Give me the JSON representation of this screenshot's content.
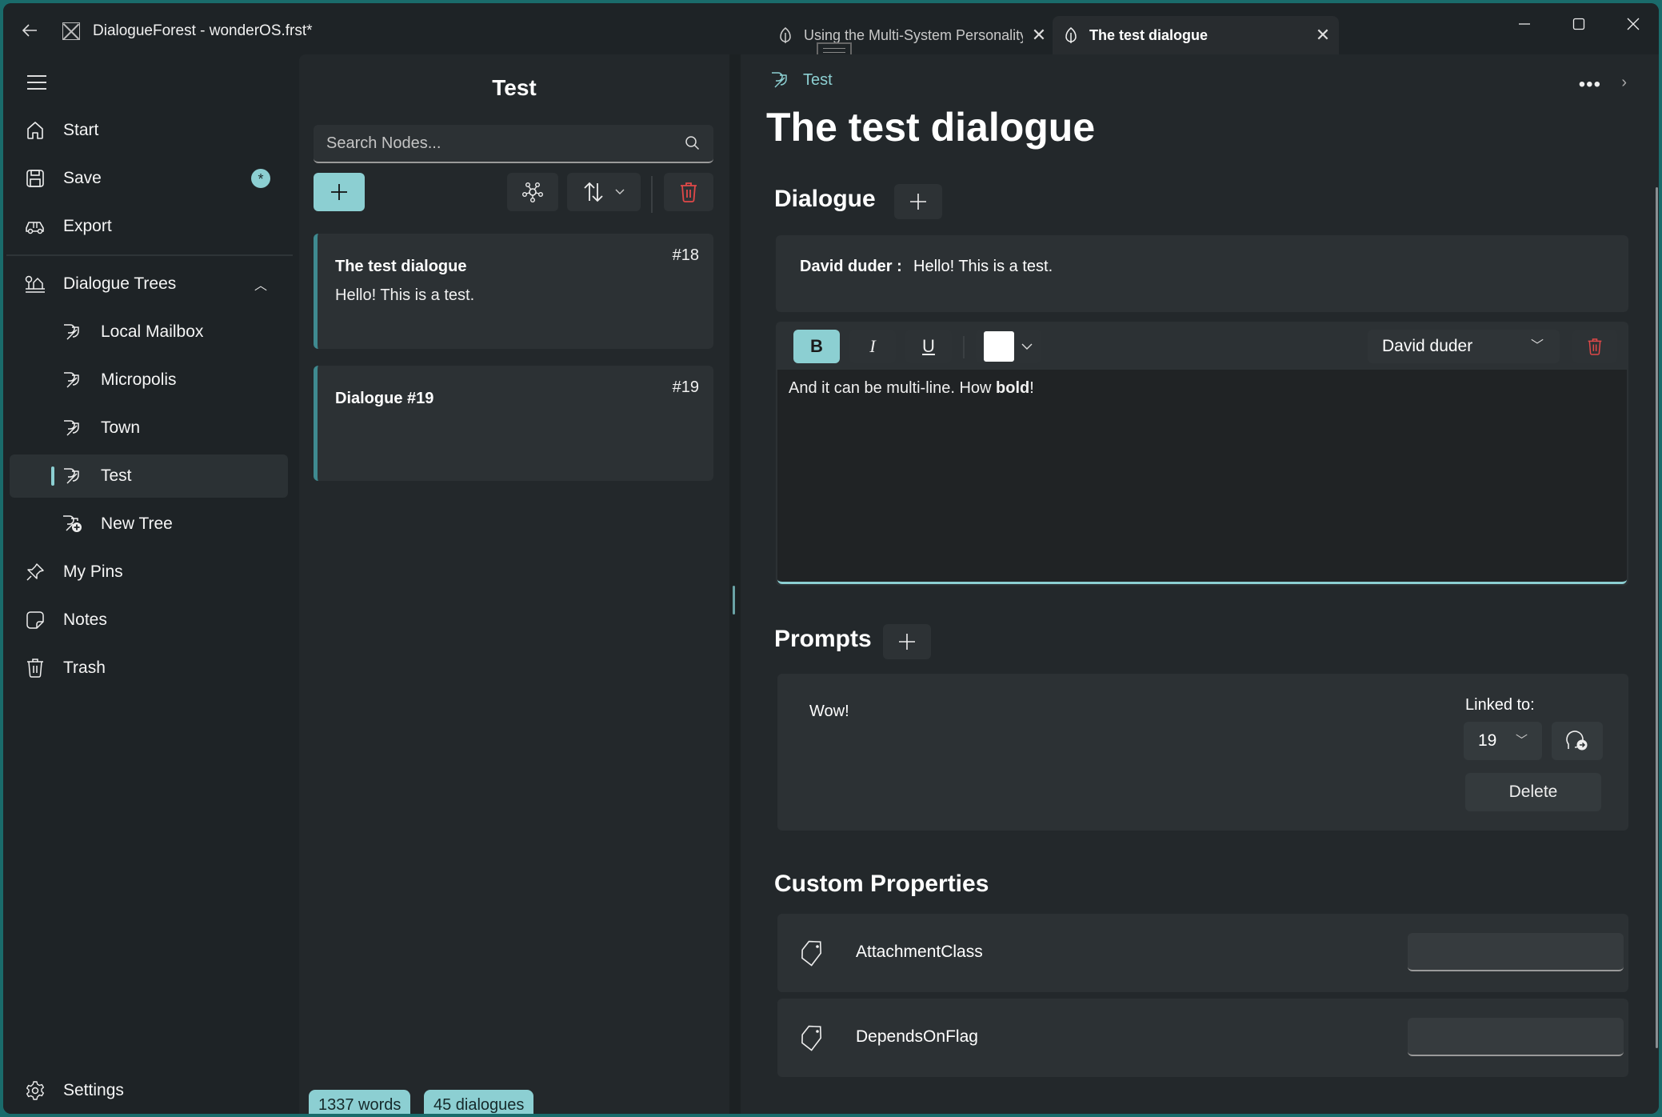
{
  "titlebar": {
    "back_icon": "arrow-left-icon",
    "app_icon": "app-logo-icon",
    "title": "DialogueForest - wonderOS.frst*",
    "tabs": [
      {
        "label": "Using the Multi-System Personality",
        "icon": "leaf-icon",
        "active": false
      },
      {
        "label": "The test dialogue",
        "icon": "leaf-icon",
        "active": true
      }
    ],
    "window_controls": [
      "minimize",
      "maximize",
      "close"
    ]
  },
  "sidebar": {
    "top_items": [
      {
        "label": "Start",
        "icon": "home-icon"
      },
      {
        "label": "Save",
        "icon": "save-icon",
        "badge": "*"
      },
      {
        "label": "Export",
        "icon": "export-icon"
      }
    ],
    "trees_header": {
      "label": "Dialogue Trees",
      "icon": "trees-icon",
      "expanded": true
    },
    "trees": [
      {
        "label": "Local Mailbox",
        "icon": "tree-icon",
        "selected": false
      },
      {
        "label": "Micropolis",
        "icon": "tree-icon",
        "selected": false
      },
      {
        "label": "Town",
        "icon": "tree-icon",
        "selected": false
      },
      {
        "label": "Test",
        "icon": "tree-icon",
        "selected": true
      },
      {
        "label": "New Tree",
        "icon": "tree-add-icon",
        "selected": false
      }
    ],
    "bottom_items": [
      {
        "label": "My Pins",
        "icon": "pin-icon"
      },
      {
        "label": "Notes",
        "icon": "note-icon"
      },
      {
        "label": "Trash",
        "icon": "trash-icon"
      }
    ],
    "settings": {
      "label": "Settings",
      "icon": "gear-icon"
    }
  },
  "node_panel": {
    "title": "Test",
    "search_placeholder": "Search Nodes...",
    "search_value": "",
    "nodes": [
      {
        "title": "The test dialogue",
        "preview": "Hello! This is a test.",
        "id": "#18"
      },
      {
        "title": "Dialogue #19",
        "preview": "",
        "id": "#19"
      }
    ],
    "stats": {
      "words": "1337 words",
      "dialogues": "45 dialogues"
    }
  },
  "main": {
    "breadcrumb": "Test",
    "title": "The test dialogue",
    "dialogue_section": "Dialogue",
    "lines": [
      {
        "speaker": "David duder :",
        "text": "Hello! This is a test."
      }
    ],
    "editor": {
      "bold_label": "B",
      "italic_label": "I",
      "underline_label": "U",
      "text_color": "#ffffff",
      "speaker": "David duder",
      "content_before": "And it can be multi-line. How ",
      "content_bold": "bold",
      "content_after": "!"
    },
    "prompts_section": "Prompts",
    "prompts": [
      {
        "text": "Wow!",
        "linked_label": "Linked to:",
        "linked_value": "19",
        "delete_label": "Delete"
      }
    ],
    "custom_properties_section": "Custom Properties",
    "properties": [
      {
        "name": "AttachmentClass",
        "value": ""
      },
      {
        "name": "DependsOnFlag",
        "value": ""
      }
    ]
  },
  "colors": {
    "accent": "#8ccfd2",
    "danger": "#e04848",
    "background": "#1e2326",
    "card": "#2c3134"
  }
}
